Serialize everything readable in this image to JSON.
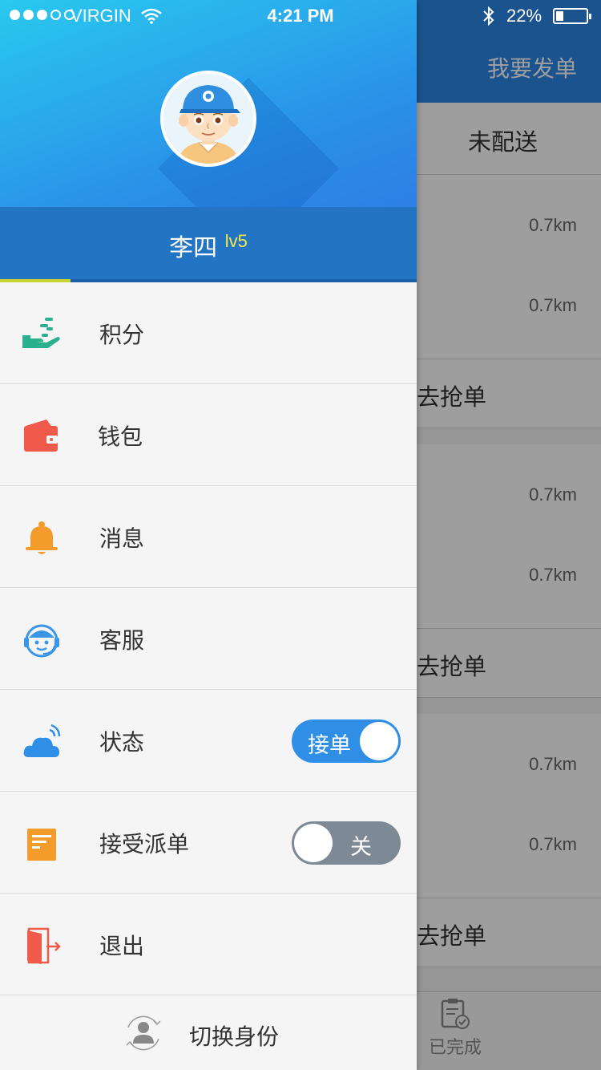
{
  "status_bar": {
    "carrier": "VIRGIN",
    "time": "4:21 PM",
    "battery": "22%",
    "signal_bars": 3,
    "battery_fraction": 0.22
  },
  "background": {
    "send_order": "我要发单",
    "tab": "未配送",
    "cards": [
      {
        "distances": [
          "0.7km",
          "0.7km"
        ],
        "action": "去抢单"
      },
      {
        "distances": [
          "0.7km",
          "0.7km"
        ],
        "action": "去抢单"
      },
      {
        "distances": [
          "0.7km",
          "0.7km"
        ],
        "action": "去抢单"
      }
    ],
    "tabbar_done": "已完成"
  },
  "drawer": {
    "user": {
      "name": "李四",
      "level": "lv5",
      "progress": 0.17
    },
    "menu": [
      {
        "label": "积分",
        "icon": "points-hand-icon"
      },
      {
        "label": "钱包",
        "icon": "wallet-icon"
      },
      {
        "label": "消息",
        "icon": "bell-icon"
      },
      {
        "label": "客服",
        "icon": "customer-service-icon"
      },
      {
        "label": "状态",
        "icon": "cloud-icon",
        "toggle": {
          "on": true,
          "label": "接单"
        }
      },
      {
        "label": "接受派单",
        "icon": "document-icon",
        "toggle": {
          "on": false,
          "label": "关"
        }
      },
      {
        "label": "退出",
        "icon": "logout-door-icon"
      }
    ],
    "switch_role": "切换身份"
  },
  "colors": {
    "accent": "#2f8fe6",
    "header_gradient_start": "#29c9ef",
    "user_bar": "#2474c4",
    "level_text": "#f5e84a",
    "progress": "#c8d530",
    "toggle_off": "#7d8a96"
  }
}
